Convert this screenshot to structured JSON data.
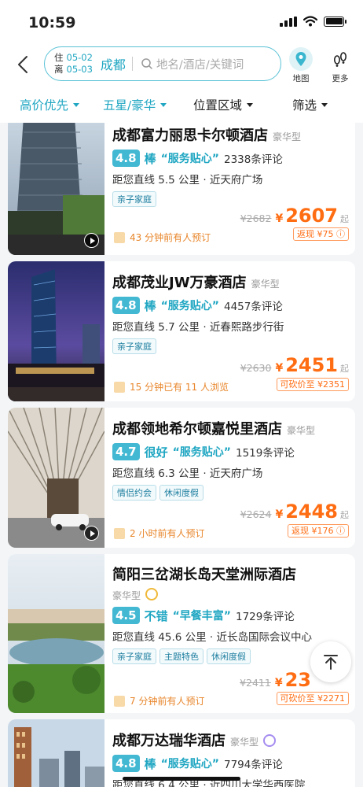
{
  "status": {
    "time": "10:59"
  },
  "search": {
    "checkin_label": "住",
    "checkout_label": "离",
    "checkin_date": "05-02",
    "checkout_date": "05-03",
    "city": "成都",
    "placeholder": "地名/酒店/关键词"
  },
  "top_buttons": {
    "map": "地图",
    "more": "更多"
  },
  "filters": [
    {
      "label": "高价优先",
      "active": true
    },
    {
      "label": "五星/豪华",
      "active": true
    },
    {
      "label": "位置区域",
      "active": false
    },
    {
      "label": "筛选",
      "active": false
    }
  ],
  "hotels": [
    {
      "name": "成都富力丽思卡尔顿酒店",
      "tier": "豪华型",
      "score": "4.8",
      "praise": "棒",
      "quote": "“服务贴心”",
      "reviews": "2338条评论",
      "distance": "距您直线 5.5 公里 · 近天府广场",
      "tags": [
        "亲子家庭"
      ],
      "old_price": "¥2682",
      "price_symbol": "¥",
      "price": "2607",
      "price_suffix": "起",
      "promo": "返现 ¥75 ⓘ",
      "booking": "43 分钟前有人预订"
    },
    {
      "name": "成都茂业JW万豪酒店",
      "tier": "豪华型",
      "score": "4.8",
      "praise": "棒",
      "quote": "“服务贴心”",
      "reviews": "4457条评论",
      "distance": "距您直线 5.7 公里 · 近春熙路步行街",
      "tags": [
        "亲子家庭"
      ],
      "old_price": "¥2630",
      "price_symbol": "¥",
      "price": "2451",
      "price_suffix": "起",
      "promo": "可砍价至 ¥2351",
      "booking": "15 分钟已有 11 人浏览"
    },
    {
      "name": "成都领地希尔顿嘉悦里酒店",
      "tier": "豪华型",
      "score": "4.7",
      "praise": "很好",
      "quote": "“服务贴心”",
      "reviews": "1519条评论",
      "distance": "距您直线 6.3 公里 · 近天府广场",
      "tags": [
        "情侣约会",
        "休闲度假"
      ],
      "old_price": "¥2624",
      "price_symbol": "¥",
      "price": "2448",
      "price_suffix": "起",
      "promo": "返现 ¥176 ⓘ",
      "booking": "2 小时前有人预订"
    },
    {
      "name": "简阳三岔湖长岛天堂洲际酒店",
      "tier": "豪华型",
      "score": "4.5",
      "praise": "不错",
      "quote": "“早餐丰富”",
      "reviews": "1729条评论",
      "distance": "距您直线 45.6 公里 · 近长岛国际会议中心",
      "tags": [
        "亲子家庭",
        "主题特色",
        "休闲度假"
      ],
      "old_price": "¥2411",
      "price_symbol": "¥",
      "price": "23",
      "price_suffix": "",
      "promo": "可砍价至 ¥2271",
      "booking": "7 分钟前有人预订"
    },
    {
      "name": "成都万达瑞华酒店",
      "tier": "豪华型",
      "score": "4.8",
      "praise": "棒",
      "quote": "“服务贴心”",
      "reviews": "7794条评论",
      "distance": "距您直线 6.4 公里 · 近四川大学华西医院",
      "tags": [],
      "old_price": "",
      "price_symbol": "",
      "price": "",
      "price_suffix": "",
      "promo": "",
      "booking": ""
    }
  ],
  "back_to_top": "不",
  "colors": {
    "accent": "#1fa6c2",
    "price": "#ff6d13",
    "score_bg": "#43b8d3"
  }
}
